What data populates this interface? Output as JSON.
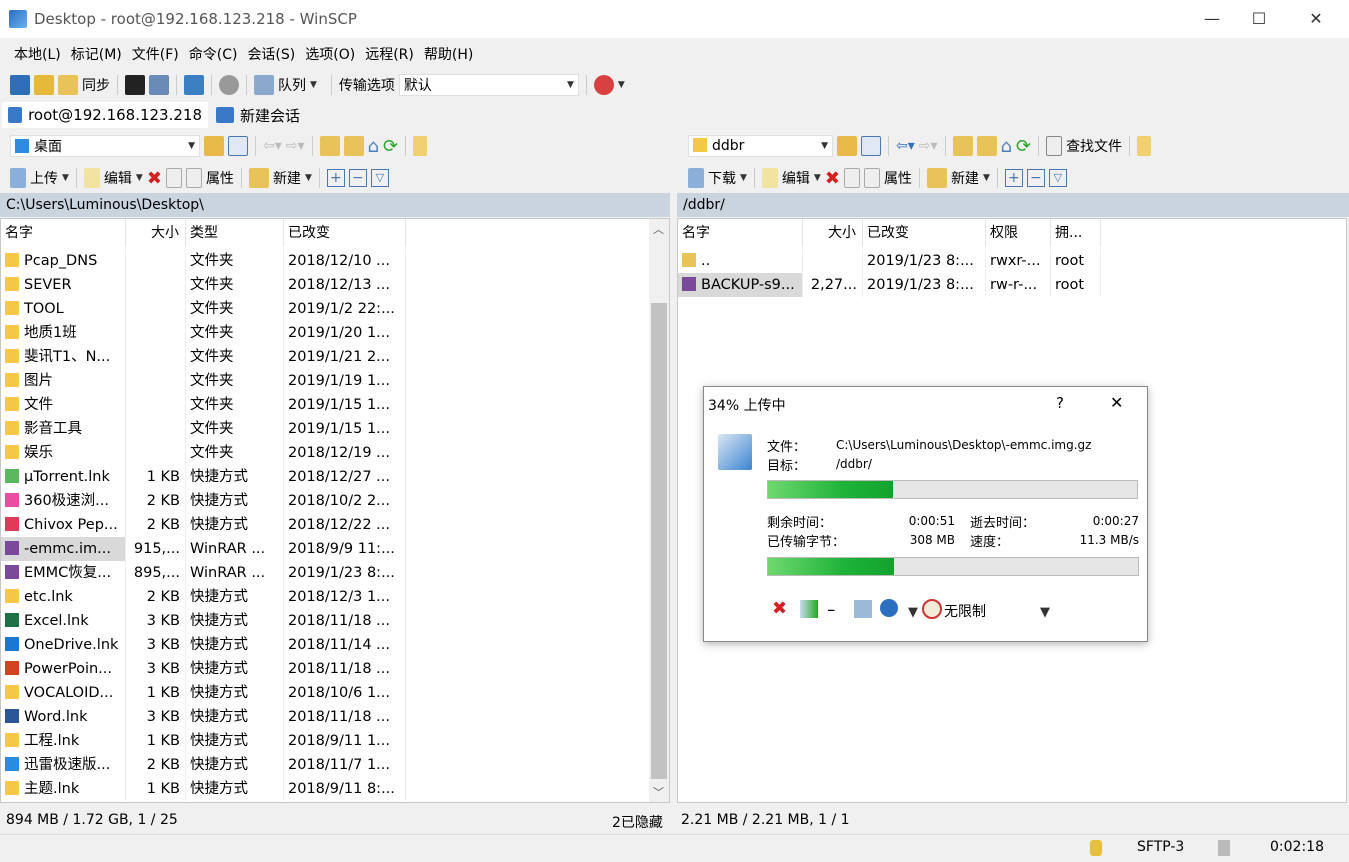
{
  "window": {
    "title": "Desktop - root@192.168.123.218 - WinSCP",
    "min": "—",
    "max": "☐",
    "close": "✕"
  },
  "menu": [
    "本地(L)",
    "标记(M)",
    "文件(F)",
    "命令(C)",
    "会话(S)",
    "选项(O)",
    "远程(R)",
    "帮助(H)"
  ],
  "toolbar": {
    "sync": "同步",
    "queue": "队列",
    "transfer_label": "传输选项",
    "transfer_value": "默认"
  },
  "tabs": [
    {
      "label": "root@192.168.123.218"
    },
    {
      "label": "新建会话"
    }
  ],
  "left": {
    "location": "桌面",
    "upload": "上传",
    "edit": "编辑",
    "properties": "属性",
    "new": "新建",
    "path": "C:\\Users\\Luminous\\Desktop\\",
    "columns": [
      "名字",
      "大小",
      "类型",
      "已改变"
    ],
    "rows": [
      [
        "Pcap_DNS",
        "",
        "文件夹",
        "2018/12/10  ...",
        "folder"
      ],
      [
        "SEVER",
        "",
        "文件夹",
        "2018/12/13  ...",
        "folder"
      ],
      [
        "TOOL",
        "",
        "文件夹",
        "2019/1/2  22:...",
        "folder"
      ],
      [
        "地质1班",
        "",
        "文件夹",
        "2019/1/20  1...",
        "folder"
      ],
      [
        "斐讯T1、N...",
        "",
        "文件夹",
        "2019/1/21  2...",
        "folder"
      ],
      [
        "图片",
        "",
        "文件夹",
        "2019/1/19  1...",
        "folder"
      ],
      [
        "文件",
        "",
        "文件夹",
        "2019/1/15  1...",
        "folder"
      ],
      [
        "影音工具",
        "",
        "文件夹",
        "2019/1/15  1...",
        "folder"
      ],
      [
        "娱乐",
        "",
        "文件夹",
        "2018/12/19  ...",
        "folder"
      ],
      [
        "µTorrent.lnk",
        "1 KB",
        "快捷方式",
        "2018/12/27  ...",
        "utorrent"
      ],
      [
        "360极速浏...",
        "2 KB",
        "快捷方式",
        "2018/10/2  2...",
        "browser"
      ],
      [
        "Chivox Pep...",
        "2 KB",
        "快捷方式",
        "2018/12/22  ...",
        "chivox"
      ],
      [
        "-emmc.im...",
        "915,...",
        "WinRAR ...",
        "2018/9/9  11:...",
        "rar"
      ],
      [
        "EMMC恢复...",
        "895,...",
        "WinRAR ...",
        "2019/1/23  8:...",
        "rar"
      ],
      [
        "etc.lnk",
        "2 KB",
        "快捷方式",
        "2018/12/3  1...",
        "folder"
      ],
      [
        "Excel.lnk",
        "3 KB",
        "快捷方式",
        "2018/11/18  ...",
        "excel"
      ],
      [
        "OneDrive.lnk",
        "3 KB",
        "快捷方式",
        "2018/11/14  ...",
        "onedrive"
      ],
      [
        "PowerPoin...",
        "3 KB",
        "快捷方式",
        "2018/11/18  ...",
        "ppt"
      ],
      [
        "VOCALOID...",
        "1 KB",
        "快捷方式",
        "2018/10/6  1...",
        "folder"
      ],
      [
        "Word.lnk",
        "3 KB",
        "快捷方式",
        "2018/11/18  ...",
        "word"
      ],
      [
        "工程.lnk",
        "1 KB",
        "快捷方式",
        "2018/9/11  1...",
        "folder"
      ],
      [
        "迅雷极速版...",
        "2 KB",
        "快捷方式",
        "2018/11/7  1...",
        "xunlei"
      ],
      [
        "主题.lnk",
        "1 KB",
        "快捷方式",
        "2018/9/11  8:...",
        "folder"
      ]
    ],
    "status": "894 MB / 1.72 GB,   1 / 25",
    "hidden": "2已隐藏"
  },
  "right": {
    "location": "ddbr",
    "download": "下载",
    "edit": "编辑",
    "properties": "属性",
    "new": "新建",
    "find": "查找文件",
    "path": "/ddbr/",
    "columns": [
      "名字",
      "大小",
      "已改变",
      "权限",
      "拥..."
    ],
    "rows": [
      [
        "..",
        "",
        "2019/1/23  8:...",
        "rwxr-...",
        "root",
        "up"
      ],
      [
        "BACKUP-s9...",
        "2,27...",
        "2019/1/23  8:...",
        "rw-r-...",
        "root",
        "rar"
      ]
    ],
    "status": "2.21 MB / 2.21 MB,   1 / 1"
  },
  "dialog": {
    "title": "34% 上传中",
    "help": "?",
    "close": "✕",
    "file_label": "文件：",
    "file": "C:\\Users\\Luminous\\Desktop\\-emmc.img.gz",
    "target_label": "目标：",
    "target": "/ddbr/",
    "file_progress": 34,
    "total_progress": 34,
    "remaining_label": "剩余时间：",
    "remaining": "0:00:51",
    "elapsed_label": "逝去时间：",
    "elapsed": "0:00:27",
    "bytes_label": "已传输字节：",
    "bytes": "308 MB",
    "speed_label": "速度：",
    "speed": "11.3 MB/s",
    "speed_limit": "无限制"
  },
  "statusbar": {
    "protocol": "SFTP-3",
    "time": "0:02:18"
  }
}
